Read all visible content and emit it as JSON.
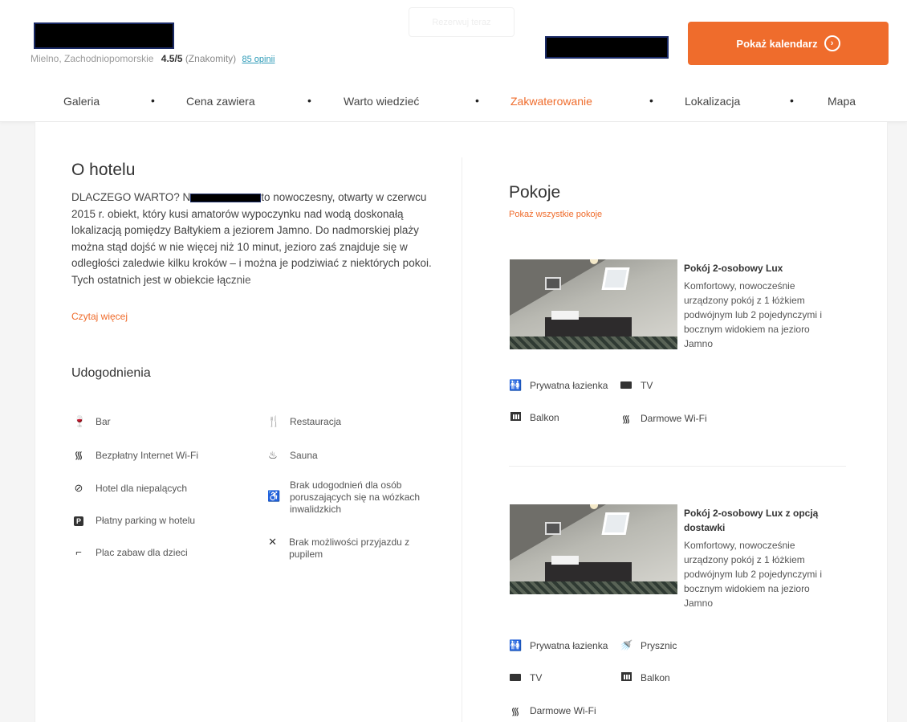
{
  "header": {
    "location": "Mielno, Zachodniopomorskie",
    "rating": "4.5/5",
    "rating_label": "(Znakomity)",
    "reviews_link": "85 opinii",
    "ghost_button": "Rezerwuj teraz",
    "calendar_button": "Pokaż kalendarz",
    "calendar_icon": "chevron-right-circle-icon"
  },
  "nav": {
    "items": [
      "Galeria",
      "Cena zawiera",
      "Warto wiedzieć",
      "Zakwaterowanie",
      "Lokalizacja",
      "Mapa"
    ],
    "active": "Zakwaterowanie",
    "separator": "•"
  },
  "about": {
    "title": "O hotelu",
    "text_start": "DLACZEGO WARTO? N",
    "text_rest": "to nowoczesny, otwarty w czerwcu 2015 r. obiekt, który kusi amatorów wypoczynku nad wodą doskonałą lokalizacją pomiędzy Bałtykiem a jeziorem Jamno. Do nadmorskiej plaży można stąd dojść w nie więcej niż 10 minut, jezioro zaś znajduje się w odległości zaledwie kilku kroków – i można je podziwiać z niektórych pokoi. Tych ostatnich jest w obiekcie łącznie",
    "read_more": "Czytaj więcej"
  },
  "amenities": {
    "title": "Udogodnienia",
    "left": [
      {
        "label": "Bar",
        "icon": "wine-glass-icon"
      },
      {
        "label": "Bezpłatny Internet Wi-Fi",
        "icon": "wifi-icon"
      },
      {
        "label": "Hotel dla niepalących",
        "icon": "no-smoking-icon"
      },
      {
        "label": "Płatny parking w hotelu",
        "icon": "parking-icon"
      },
      {
        "label": "Plac zabaw dla dzieci",
        "icon": "playground-icon"
      }
    ],
    "right": [
      {
        "label": "Restauracja",
        "icon": "cutlery-icon"
      },
      {
        "label": "Sauna",
        "icon": "sauna-icon"
      },
      {
        "label": "Brak udogodnień dla osób poruszających się na wózkach inwalidzkich",
        "icon": "wheelchair-crossed-icon"
      },
      {
        "label": "Brak możliwości przyjazdu z pupilem",
        "icon": "no-pets-icon"
      }
    ]
  },
  "rooms": {
    "title": "Pokoje",
    "show_all": "Pokaż wszystkie pokoje",
    "list": [
      {
        "name": "Pokój 2-osobowy Lux",
        "description": "Komfortowy, nowocześnie urządzony pokój z 1 łóżkiem podwójnym lub 2 pojedynczymi i bocznym widokiem na jezioro Jamno",
        "features": [
          "Prywatna łazienka",
          "TV",
          "Balkon",
          "Darmowe Wi-Fi"
        ]
      },
      {
        "name": "Pokój 2-osobowy Lux z opcją dostawki",
        "description": "Komfortowy, nowocześnie urządzony pokój z 1 łóżkiem podwójnym lub 2 pojedynczymi i bocznym widokiem na jezioro Jamno",
        "features": [
          "Prywatna łazienka",
          "Prysznic",
          "TV",
          "Balkon",
          "Darmowe Wi-Fi"
        ]
      }
    ]
  },
  "colors": {
    "accent": "#ef6c2c",
    "link": "#2c9ab7",
    "text": "#333333"
  }
}
